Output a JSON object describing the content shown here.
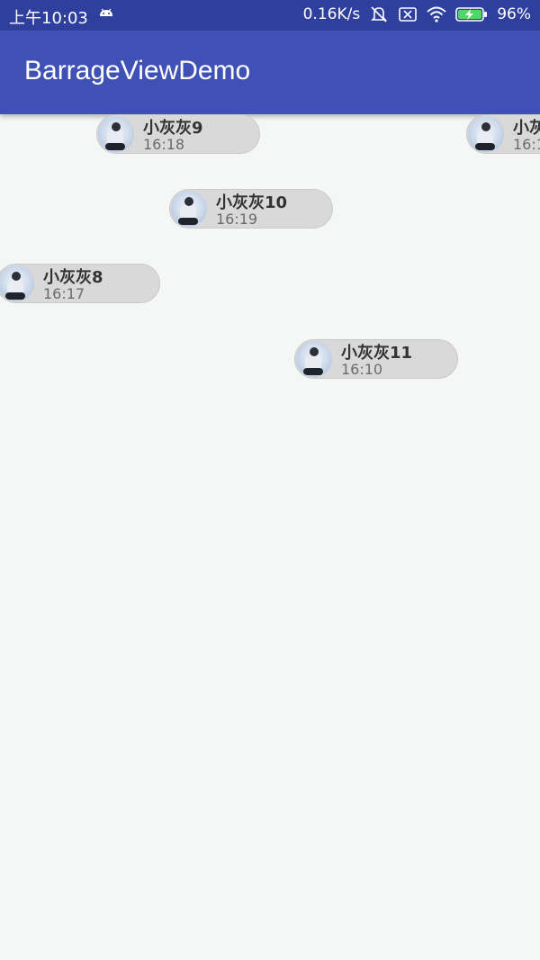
{
  "status_bar": {
    "time": "上午10:03",
    "net_speed": "0.16K/s",
    "battery": "96%",
    "icons": [
      "android-icon",
      "mute-icon",
      "sim-x-icon",
      "wifi-icon",
      "battery-charging-icon"
    ]
  },
  "app_bar": {
    "title": "BarrageViewDemo"
  },
  "barrages": [
    {
      "name": "小灰灰9",
      "time": "16:18"
    },
    {
      "name": "小灰",
      "time": "16:1"
    },
    {
      "name": "小灰灰10",
      "time": "16:19"
    },
    {
      "name": "小灰灰8",
      "time": "16:17"
    },
    {
      "name": "小灰灰11",
      "time": "16:10"
    }
  ],
  "colors": {
    "status_bar": "#2f3f9e",
    "app_bar": "#3f51b5",
    "background": "#f4f7f6",
    "bubble": "#d9d9d9"
  }
}
